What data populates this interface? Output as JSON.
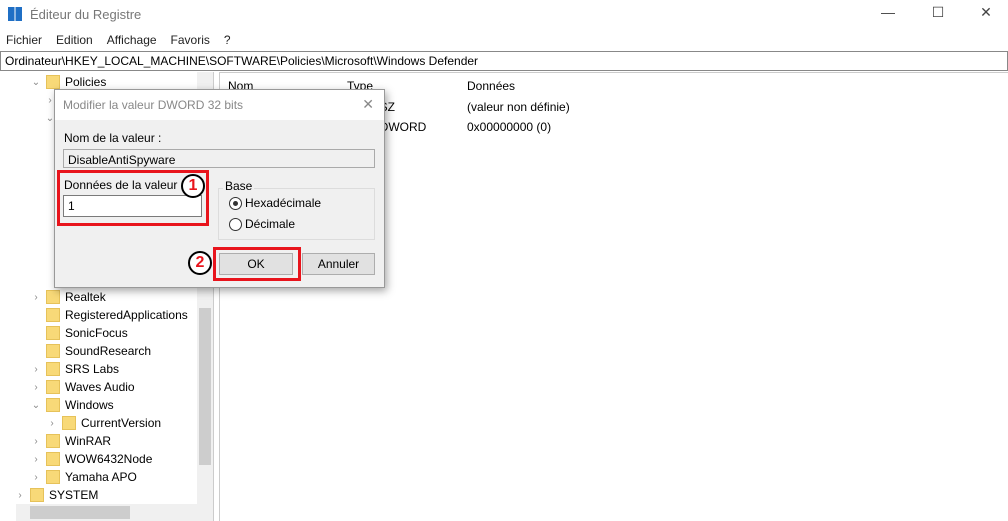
{
  "window": {
    "title": "Éditeur du Registre",
    "minimize": "—",
    "maximize": "☐",
    "close": "✕"
  },
  "menu": [
    "Fichier",
    "Edition",
    "Affichage",
    "Favoris",
    "?"
  ],
  "address": "Ordinateur\\HKEY_LOCAL_MACHINE\\SOFTWARE\\Policies\\Microsoft\\Windows Defender",
  "tree": {
    "policies": "Policies",
    "items": [
      "Realtek",
      "RegisteredApplications",
      "SonicFocus",
      "SoundResearch",
      "SRS Labs",
      "Waves Audio",
      "Windows",
      "CurrentVersion",
      "WinRAR",
      "WOW6432Node",
      "Yamaha APO",
      "SYSTEM"
    ]
  },
  "list": {
    "headers": [
      "Nom",
      "Type",
      "Données"
    ],
    "rows": [
      {
        "type": "REG_SZ",
        "data": "(valeur non définie)"
      },
      {
        "type": "REG_DWORD",
        "data": "0x00000000 (0)"
      }
    ]
  },
  "dialog": {
    "title": "Modifier la valeur DWORD 32 bits",
    "name_label": "Nom de la valeur :",
    "name_value": "DisableAntiSpyware",
    "data_label": "Données de la valeur :",
    "data_value": "1",
    "base_label": "Base",
    "hex_label": "Hexadécimale",
    "dec_label": "Décimale",
    "hex_selected": true,
    "ok": "OK",
    "cancel": "Annuler",
    "close": "✕"
  },
  "annotations": {
    "step1": "1",
    "step2": "2",
    "color": "#e8141c"
  }
}
